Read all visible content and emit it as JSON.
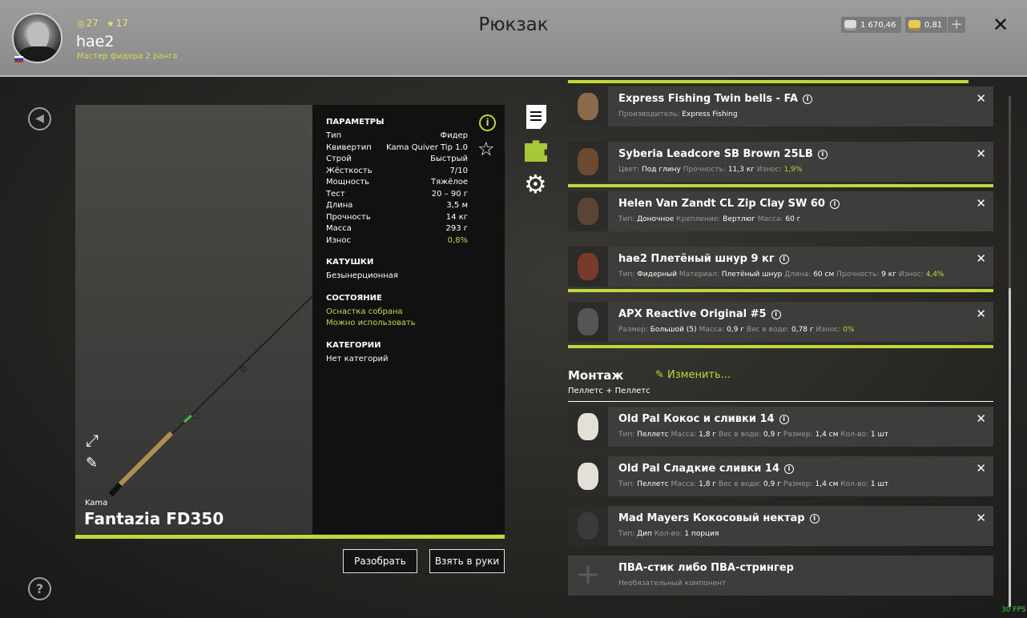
{
  "header": {
    "title": "Рюкзак",
    "player": {
      "name": "hae2",
      "rank": "Мастер фидера 2 ранга",
      "level1": "27",
      "level2": "17"
    },
    "silver": "1 670,46",
    "gold": "0,81",
    "add_label": "+",
    "close_label": "✕"
  },
  "rod": {
    "brand": "Kama",
    "name": "Fantazia FD350",
    "params_title": "ПАРАМЕТРЫ",
    "params": [
      {
        "k": "Тип",
        "v": "Фидер"
      },
      {
        "k": "Квивертип",
        "v": "Kama Quiver Tip 1.0"
      },
      {
        "k": "Строй",
        "v": "Быстрый"
      },
      {
        "k": "Жёсткость",
        "v": "7/10"
      },
      {
        "k": "Мощность",
        "v": "Тяжёлое"
      },
      {
        "k": "Тест",
        "v": "20 – 90 г"
      },
      {
        "k": "Длина",
        "v": "3,5 м"
      },
      {
        "k": "Прочность",
        "v": "14 кг"
      },
      {
        "k": "Масса",
        "v": "293 г"
      },
      {
        "k": "Износ",
        "v": "0,8%"
      }
    ],
    "reels_title": "КАТУШКИ",
    "reel": "Безынерционная",
    "state_title": "СОСТОЯНИЕ",
    "state1": "Оснастка собрана",
    "state2": "Можно использовать",
    "cat_title": "КАТЕГОРИИ",
    "cat": "Нет категорий",
    "btn_disassemble": "Разобрать",
    "btn_take": "Взять в руки"
  },
  "items": [
    {
      "name": "Express Fishing Twin bells - FA",
      "desc": [
        [
          "Производитель: ",
          "Express Fishing"
        ]
      ]
    },
    {
      "name": "Syberia Leadcore SB Brown 25LB",
      "desc": [
        [
          "Цвет: ",
          "Под глину"
        ],
        [
          " Прочность: ",
          "11,3 кг"
        ],
        [
          " Износ: ",
          "1,9%"
        ]
      ]
    },
    {
      "name": "Helen Van Zandt CL Zip Clay SW 60",
      "desc": [
        [
          "Тип: ",
          "Доночное"
        ],
        [
          " Крепление: ",
          "Вертлюг"
        ],
        [
          " Масса: ",
          "60 г"
        ]
      ]
    },
    {
      "name": "hae2 Плетёный шнур 9 кг",
      "desc": [
        [
          "Тип: ",
          "Фидерный"
        ],
        [
          " Материал: ",
          "Плетёный шнур"
        ],
        [
          " Длина: ",
          "60 см"
        ],
        [
          " Прочность: ",
          "9 кг"
        ],
        [
          " Износ: ",
          "4,4%"
        ]
      ]
    },
    {
      "name": "APX Reactive Original #5",
      "desc": [
        [
          "Размер: ",
          "Большой (5)"
        ],
        [
          " Масса: ",
          "0,9 г"
        ],
        [
          " Вес в воде: ",
          "0,78 г"
        ],
        [
          " Износ: ",
          "0%"
        ]
      ]
    }
  ],
  "montage": {
    "title": "Монтаж",
    "edit": "Изменить...",
    "subtitle": "Пеллетс + Пеллетс",
    "items": [
      {
        "name": "Old Pal Кокос и сливки 14",
        "desc": [
          [
            "Тип: ",
            "Пеллетс"
          ],
          [
            " Масса: ",
            "1,8 г"
          ],
          [
            " Вес в воде: ",
            "0,9 г"
          ],
          [
            " Размер: ",
            "1,4 см"
          ],
          [
            " Кол-во: ",
            "1 шт"
          ]
        ]
      },
      {
        "name": "Old Pal Сладкие сливки 14",
        "desc": [
          [
            "Тип: ",
            "Пеллетс"
          ],
          [
            " Масса: ",
            "1,8 г"
          ],
          [
            " Вес в воде: ",
            "0,9 г"
          ],
          [
            " Размер: ",
            "1,4 см"
          ],
          [
            " Кол-во: ",
            "1 шт"
          ]
        ]
      },
      {
        "name": "Mad Mayers Кокосовый нектар",
        "desc": [
          [
            "Тип: ",
            "Дип"
          ],
          [
            " Кол-во: ",
            "1 порция"
          ]
        ]
      }
    ],
    "optional": {
      "name": "ПВА-стик либо ПВА-стрингер",
      "desc": "Необязательный компонент"
    }
  },
  "fps": "30 FPS",
  "colors": {
    "accent": "#c2d83a",
    "panel": "#3d3d3b",
    "header": "#9a9a9a"
  }
}
